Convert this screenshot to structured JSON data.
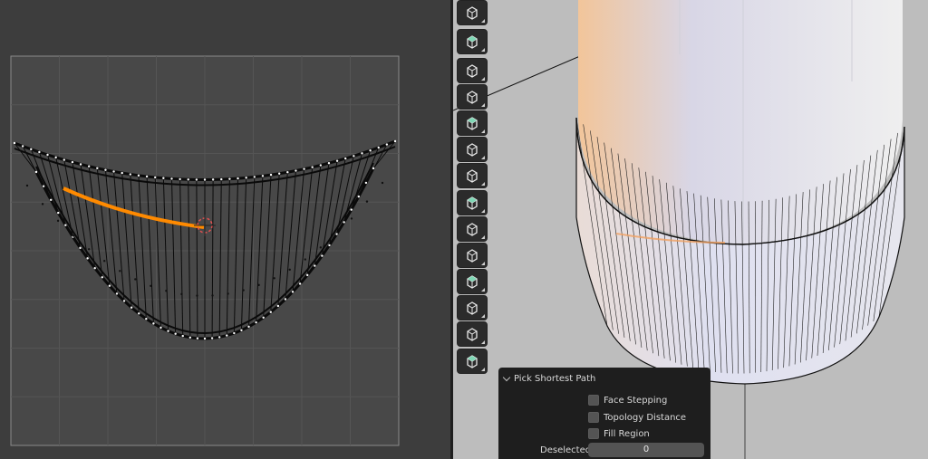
{
  "operator_panel": {
    "title": "Pick Shortest Path",
    "options": [
      {
        "label": "Face Stepping",
        "checked": false
      },
      {
        "label": "Topology Distance",
        "checked": false
      },
      {
        "label": "Fill Region",
        "checked": false
      }
    ],
    "deselected_label": "Deselected",
    "deselected_value": "0"
  },
  "toolbar": {
    "tools": [
      {
        "name": "measure-tool-icon"
      },
      {
        "name": "add-cube-tool-icon"
      },
      {
        "name": "extrude-region-icon"
      },
      {
        "name": "inset-faces-icon"
      },
      {
        "name": "bevel-icon"
      },
      {
        "name": "loop-cut-icon"
      },
      {
        "name": "knife-icon"
      },
      {
        "name": "poly-build-icon"
      },
      {
        "name": "spin-icon"
      },
      {
        "name": "smooth-icon"
      },
      {
        "name": "edge-slide-icon"
      },
      {
        "name": "shrink-fatten-icon"
      },
      {
        "name": "shear-icon"
      },
      {
        "name": "rip-region-icon"
      }
    ]
  },
  "colors": {
    "selection": "#ff8a00",
    "toolbar_accent": "#7fd8b5",
    "panel_bg": "#1e1e1e"
  }
}
